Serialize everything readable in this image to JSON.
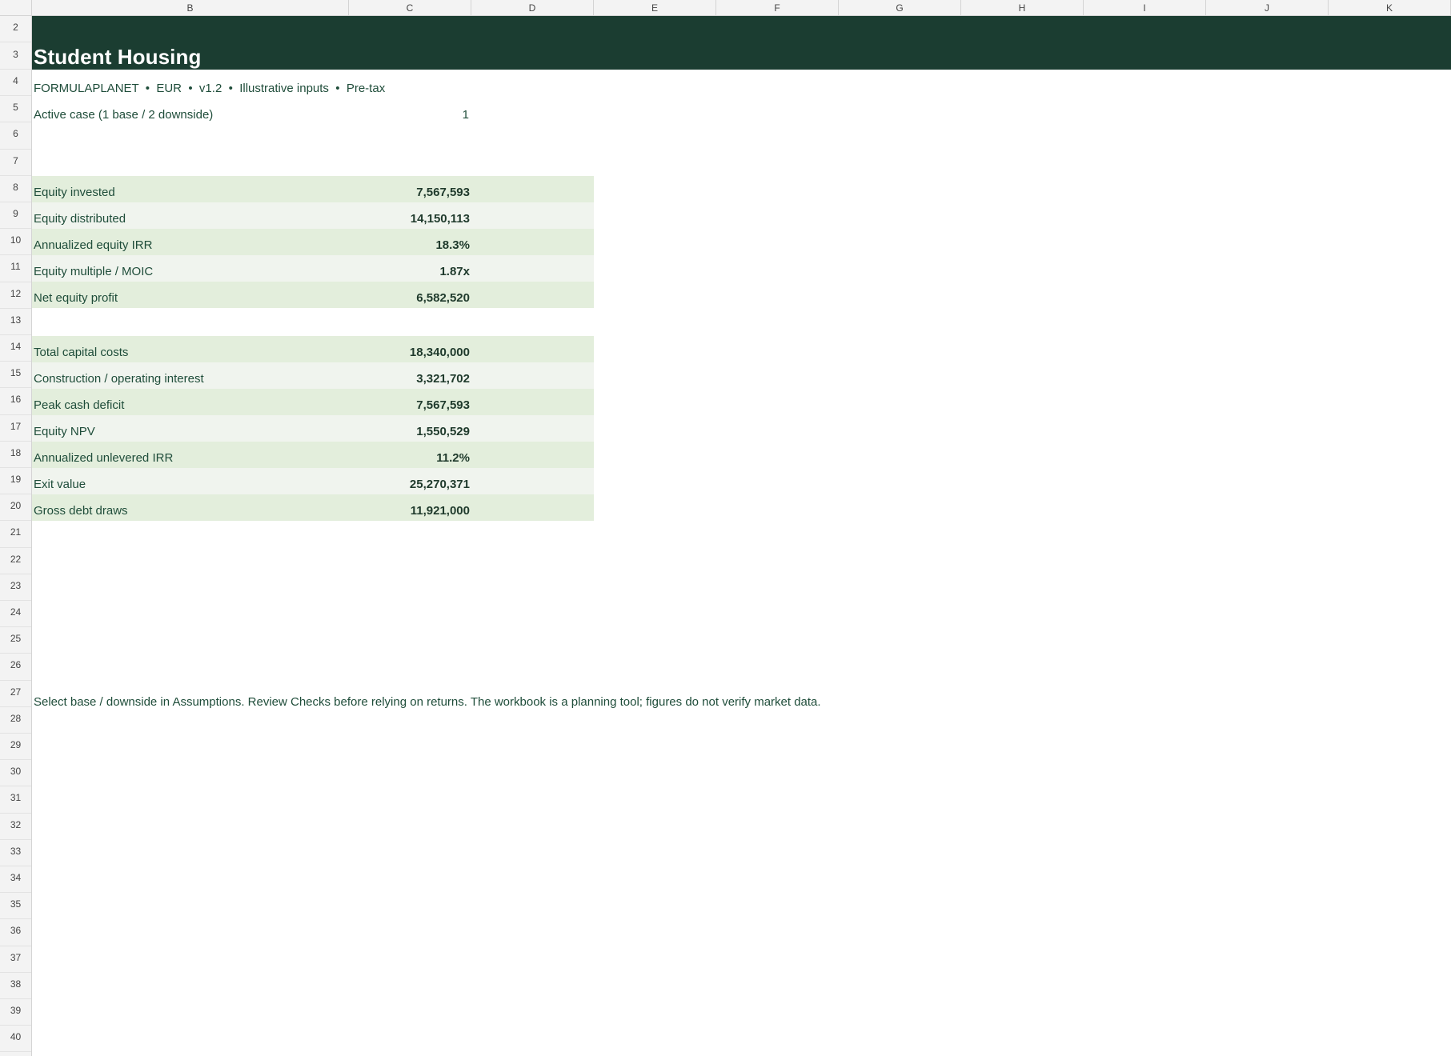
{
  "sheet": {
    "columns": [
      "B",
      "C",
      "D",
      "E",
      "F",
      "G",
      "H",
      "I",
      "J",
      "K"
    ],
    "rows": [
      "2",
      "3",
      "4",
      "5",
      "6",
      "7",
      "8",
      "9",
      "10",
      "11",
      "12",
      "13",
      "14",
      "15",
      "16",
      "17",
      "18",
      "19",
      "20",
      "21",
      "22",
      "23",
      "24",
      "25",
      "26",
      "27",
      "28",
      "29",
      "30",
      "31",
      "32",
      "33",
      "34",
      "35",
      "36",
      "37",
      "38",
      "39",
      "40"
    ]
  },
  "title": "Student Housing",
  "subtitle": "FORMULAPLANET  •  EUR  •  v1.2  •  Illustrative inputs  •  Pre-tax",
  "active_case": {
    "label": "Active case (1 base / 2 downside)",
    "value": "1"
  },
  "returns": [
    {
      "label": "Equity invested",
      "value": "7,567,593"
    },
    {
      "label": "Equity distributed",
      "value": "14,150,113"
    },
    {
      "label": "Annualized equity IRR",
      "value": "18.3%"
    },
    {
      "label": "Equity multiple / MOIC",
      "value": "1.87x"
    },
    {
      "label": "Net equity profit",
      "value": "6,582,520"
    }
  ],
  "costs": [
    {
      "label": "Total capital costs",
      "value": "18,340,000"
    },
    {
      "label": "Construction / operating interest",
      "value": "3,321,702"
    },
    {
      "label": "Peak cash deficit",
      "value": "7,567,593"
    },
    {
      "label": "Equity NPV",
      "value": "1,550,529"
    },
    {
      "label": "Annualized unlevered IRR",
      "value": "11.2%"
    },
    {
      "label": "Exit value",
      "value": "25,270,371"
    },
    {
      "label": "Gross debt draws",
      "value": "11,921,000"
    }
  ],
  "footnote": "Select base / downside in Assumptions. Review Checks before relying on returns. The workbook is a planning tool; figures do not verify market data.",
  "colors": {
    "title_band": "#1b3d31",
    "shade_a": "#e3eedc",
    "shade_b": "#f0f4ee",
    "text": "#1f4d3a"
  }
}
